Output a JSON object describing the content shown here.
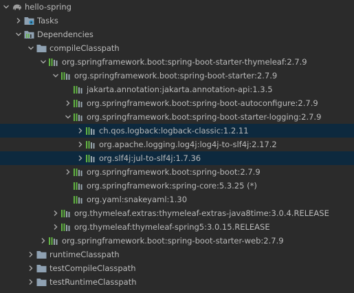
{
  "colors": {
    "background": "#2b2b2b",
    "text": "#bbbbbb",
    "selection": "#0d293e",
    "arrow": "#a9a9a9",
    "folder": "#8fa1b2",
    "library_bar_green": "#62b543",
    "library_bar_gray": "#9aa7b0"
  },
  "tree": {
    "rows": [
      {
        "label": "hello-spring",
        "depth": 0,
        "arrow": "down",
        "icon": "elephant-icon",
        "selected": false
      },
      {
        "label": "Tasks",
        "depth": 1,
        "arrow": "right",
        "icon": "tasks-folder-icon",
        "selected": false
      },
      {
        "label": "Dependencies",
        "depth": 1,
        "arrow": "down",
        "icon": "dependencies-folder-icon",
        "selected": false
      },
      {
        "label": "compileClasspath",
        "depth": 2,
        "arrow": "down",
        "icon": "folder-icon",
        "selected": false
      },
      {
        "label": "org.springframework.boot:spring-boot-starter-thymeleaf:2.7.9",
        "depth": 3,
        "arrow": "down",
        "icon": "library-icon",
        "selected": false
      },
      {
        "label": "org.springframework.boot:spring-boot-starter:2.7.9",
        "depth": 4,
        "arrow": "down",
        "icon": "library-icon",
        "selected": false
      },
      {
        "label": "jakarta.annotation:jakarta.annotation-api:1.3.5",
        "depth": 5,
        "arrow": "none",
        "icon": "library-icon",
        "selected": false
      },
      {
        "label": "org.springframework.boot:spring-boot-autoconfigure:2.7.9",
        "depth": 5,
        "arrow": "right",
        "icon": "library-icon",
        "selected": false
      },
      {
        "label": "org.springframework.boot:spring-boot-starter-logging:2.7.9",
        "depth": 5,
        "arrow": "down",
        "icon": "library-icon",
        "selected": false
      },
      {
        "label": "ch.qos.logback:logback-classic:1.2.11",
        "depth": 6,
        "arrow": "right",
        "icon": "library-icon",
        "selected": true
      },
      {
        "label": "org.apache.logging.log4j:log4j-to-slf4j:2.17.2",
        "depth": 6,
        "arrow": "right",
        "icon": "library-icon",
        "selected": false
      },
      {
        "label": "org.slf4j:jul-to-slf4j:1.7.36",
        "depth": 6,
        "arrow": "right",
        "icon": "library-icon",
        "selected": true
      },
      {
        "label": "org.springframework.boot:spring-boot:2.7.9",
        "depth": 5,
        "arrow": "right",
        "icon": "library-icon",
        "selected": false
      },
      {
        "label": "org.springframework:spring-core:5.3.25 (*)",
        "depth": 5,
        "arrow": "none",
        "icon": "library-icon",
        "selected": false
      },
      {
        "label": "org.yaml:snakeyaml:1.30",
        "depth": 5,
        "arrow": "none",
        "icon": "library-icon",
        "selected": false
      },
      {
        "label": "org.thymeleaf.extras:thymeleaf-extras-java8time:3.0.4.RELEASE",
        "depth": 4,
        "arrow": "right",
        "icon": "library-icon",
        "selected": false
      },
      {
        "label": "org.thymeleaf:thymeleaf-spring5:3.0.15.RELEASE",
        "depth": 4,
        "arrow": "right",
        "icon": "library-icon",
        "selected": false
      },
      {
        "label": "org.springframework.boot:spring-boot-starter-web:2.7.9",
        "depth": 3,
        "arrow": "right",
        "icon": "library-icon",
        "selected": false
      },
      {
        "label": "runtimeClasspath",
        "depth": 2,
        "arrow": "right",
        "icon": "folder-icon",
        "selected": false
      },
      {
        "label": "testCompileClasspath",
        "depth": 2,
        "arrow": "right",
        "icon": "folder-icon",
        "selected": false
      },
      {
        "label": "testRuntimeClasspath",
        "depth": 2,
        "arrow": "right",
        "icon": "folder-icon",
        "selected": false
      }
    ]
  }
}
